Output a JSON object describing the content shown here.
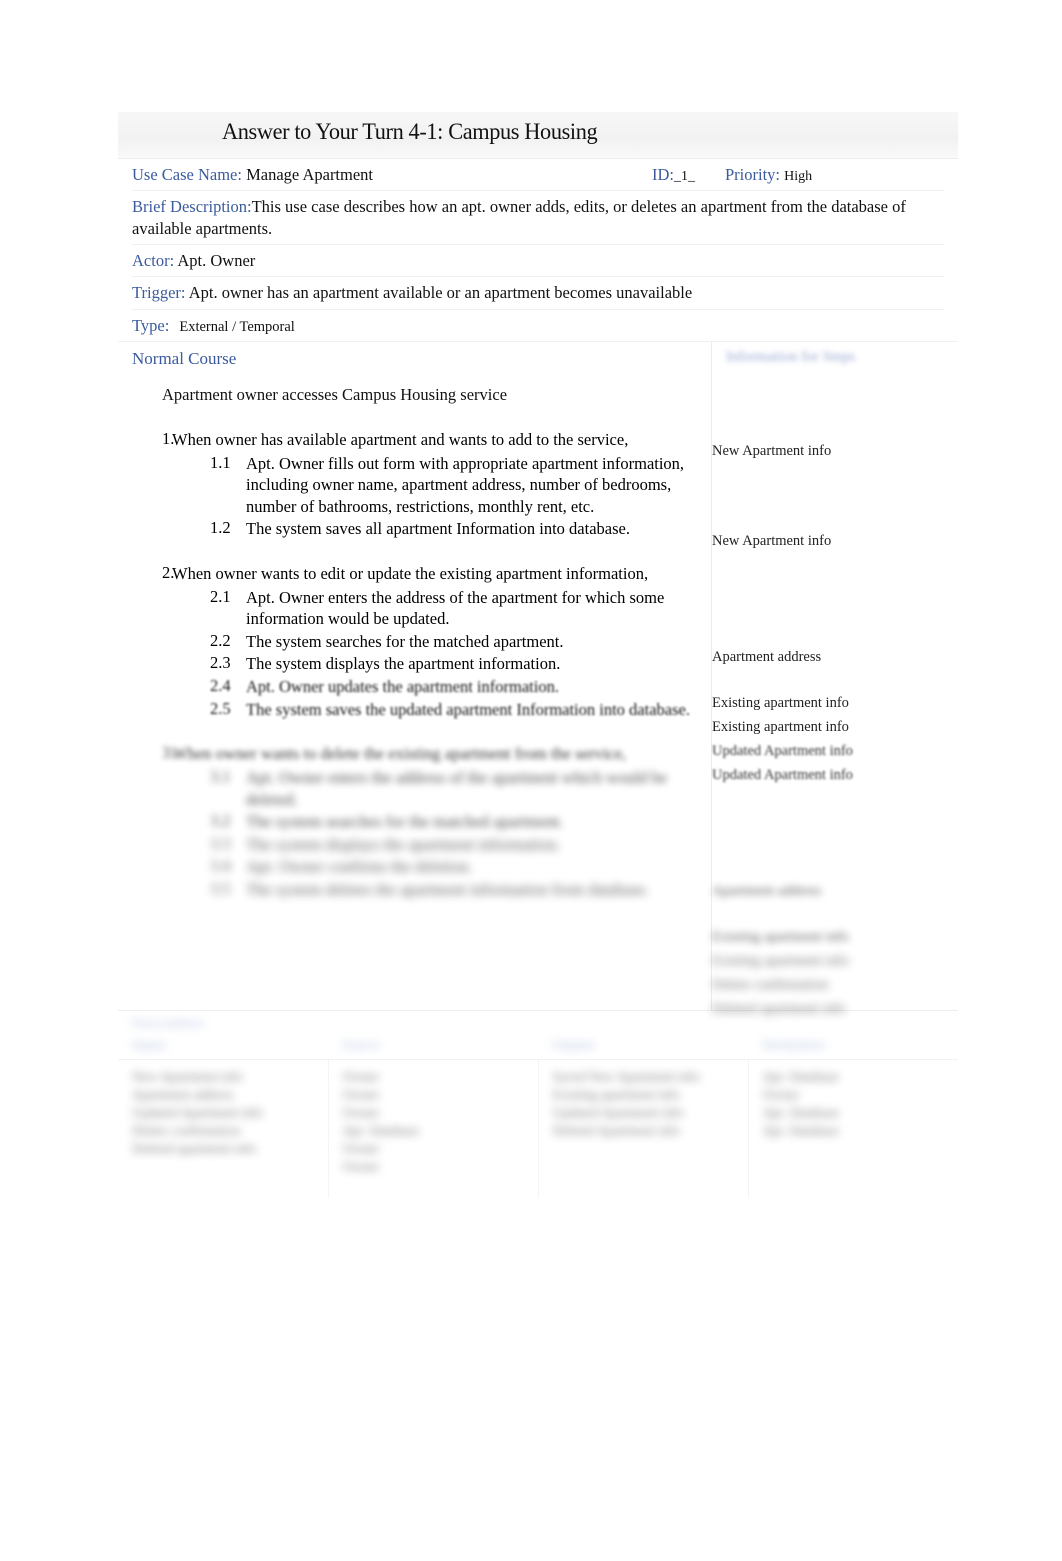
{
  "document": {
    "title": "Answer to Your Turn 4-1: Campus Housing",
    "accent_color": "#3B5B9E",
    "muted_accent_color": "#8fa4d1",
    "page_background": "#ffffff"
  },
  "header": {
    "use_case_name_label": "Use Case Name:",
    "use_case_name_value": "Manage Apartment",
    "id_label": "ID:",
    "id_value": "_1_",
    "priority_label": "Priority:",
    "priority_value": "High",
    "brief_description_label": "Brief Description:",
    "brief_description_value": "This use case describes how an apt. owner adds, edits, or deletes an apartment from the database of available apartments.",
    "actor_label": "Actor:",
    "actor_value": " Apt. Owner",
    "trigger_label": "Trigger:",
    "trigger_value": " Apt. owner has an apartment available or an apartment becomes unavailable",
    "type_label": "Type:",
    "type_value": "External  / Temporal"
  },
  "normal_course": {
    "section_label": "Normal Course",
    "right_column_label": "Information for Steps",
    "intro": "Apartment owner accesses Campus Housing service",
    "steps": [
      {
        "number": "1.",
        "text": "When owner has available apartment and wants to add to the service,",
        "substeps": [
          {
            "number": "1.1",
            "text": "Apt. Owner fills out form with appropriate apartment information, including owner name, apartment address, number of bedrooms, number of bathrooms, restrictions, monthly rent, etc.",
            "info": "New Apartment info"
          },
          {
            "number": "1.2",
            "text": "The system saves all apartment Information into database.",
            "info": "New Apartment info"
          }
        ]
      },
      {
        "number": "2.",
        "text": "When owner wants to edit or update the existing apartment information,",
        "substeps": [
          {
            "number": "2.1",
            "text": "Apt. Owner enters the address of the apartment for which some information would be updated.",
            "info": "Apartment address"
          },
          {
            "number": "2.2",
            "text": "The system searches for the matched apartment.",
            "info": "Existing apartment info"
          },
          {
            "number": "2.3",
            "text": "The system displays the apartment information.",
            "info": "Existing apartment info"
          },
          {
            "number": "2.4",
            "text": "Apt. Owner updates the apartment information.",
            "info": "Updated Apartment info"
          },
          {
            "number": "2.5",
            "text": "The system saves the updated apartment Information into database.",
            "info": "Updated Apartment info"
          }
        ]
      },
      {
        "number": "3.",
        "text": "When owner wants to delete the existing apartment from the service,",
        "substeps": [
          {
            "number": "3.1",
            "text": "Apt. Owner enters the address of the apartment which would be deleted.",
            "info": "Apartment address"
          },
          {
            "number": "3.2",
            "text": "The system searches for the matched apartment.",
            "info": "Existing apartment info"
          },
          {
            "number": "3.3",
            "text": "The system displays the apartment information.",
            "info": "Existing apartment info"
          },
          {
            "number": "3.4",
            "text": "Apt. Owner confirms the deletion.",
            "info": "Delete confirmation"
          },
          {
            "number": "3.5",
            "text": "The system deletes the apartment information from database.",
            "info": "Deleted apartment info"
          }
        ]
      }
    ]
  },
  "bottom_table": {
    "section_label": "Postcondition",
    "columns": [
      "Inputs",
      "Source",
      "Outputs",
      "Destination"
    ],
    "rows": [
      {
        "inputs": "New Apartment info\nApartment address\nUpdated Apartment info\nDelete confirmation\nDeleted apartment info",
        "source": "Owner\nOwner\nOwner\nApt. Database\nOwner\nOwner",
        "outputs": "Saved New Apartment info\nExisting apartment info\nUpdated Apartment info\nDeleted Apartment info",
        "destination": "Apt. Database\nOwner\nApt. Database\nApt. Database"
      }
    ]
  }
}
